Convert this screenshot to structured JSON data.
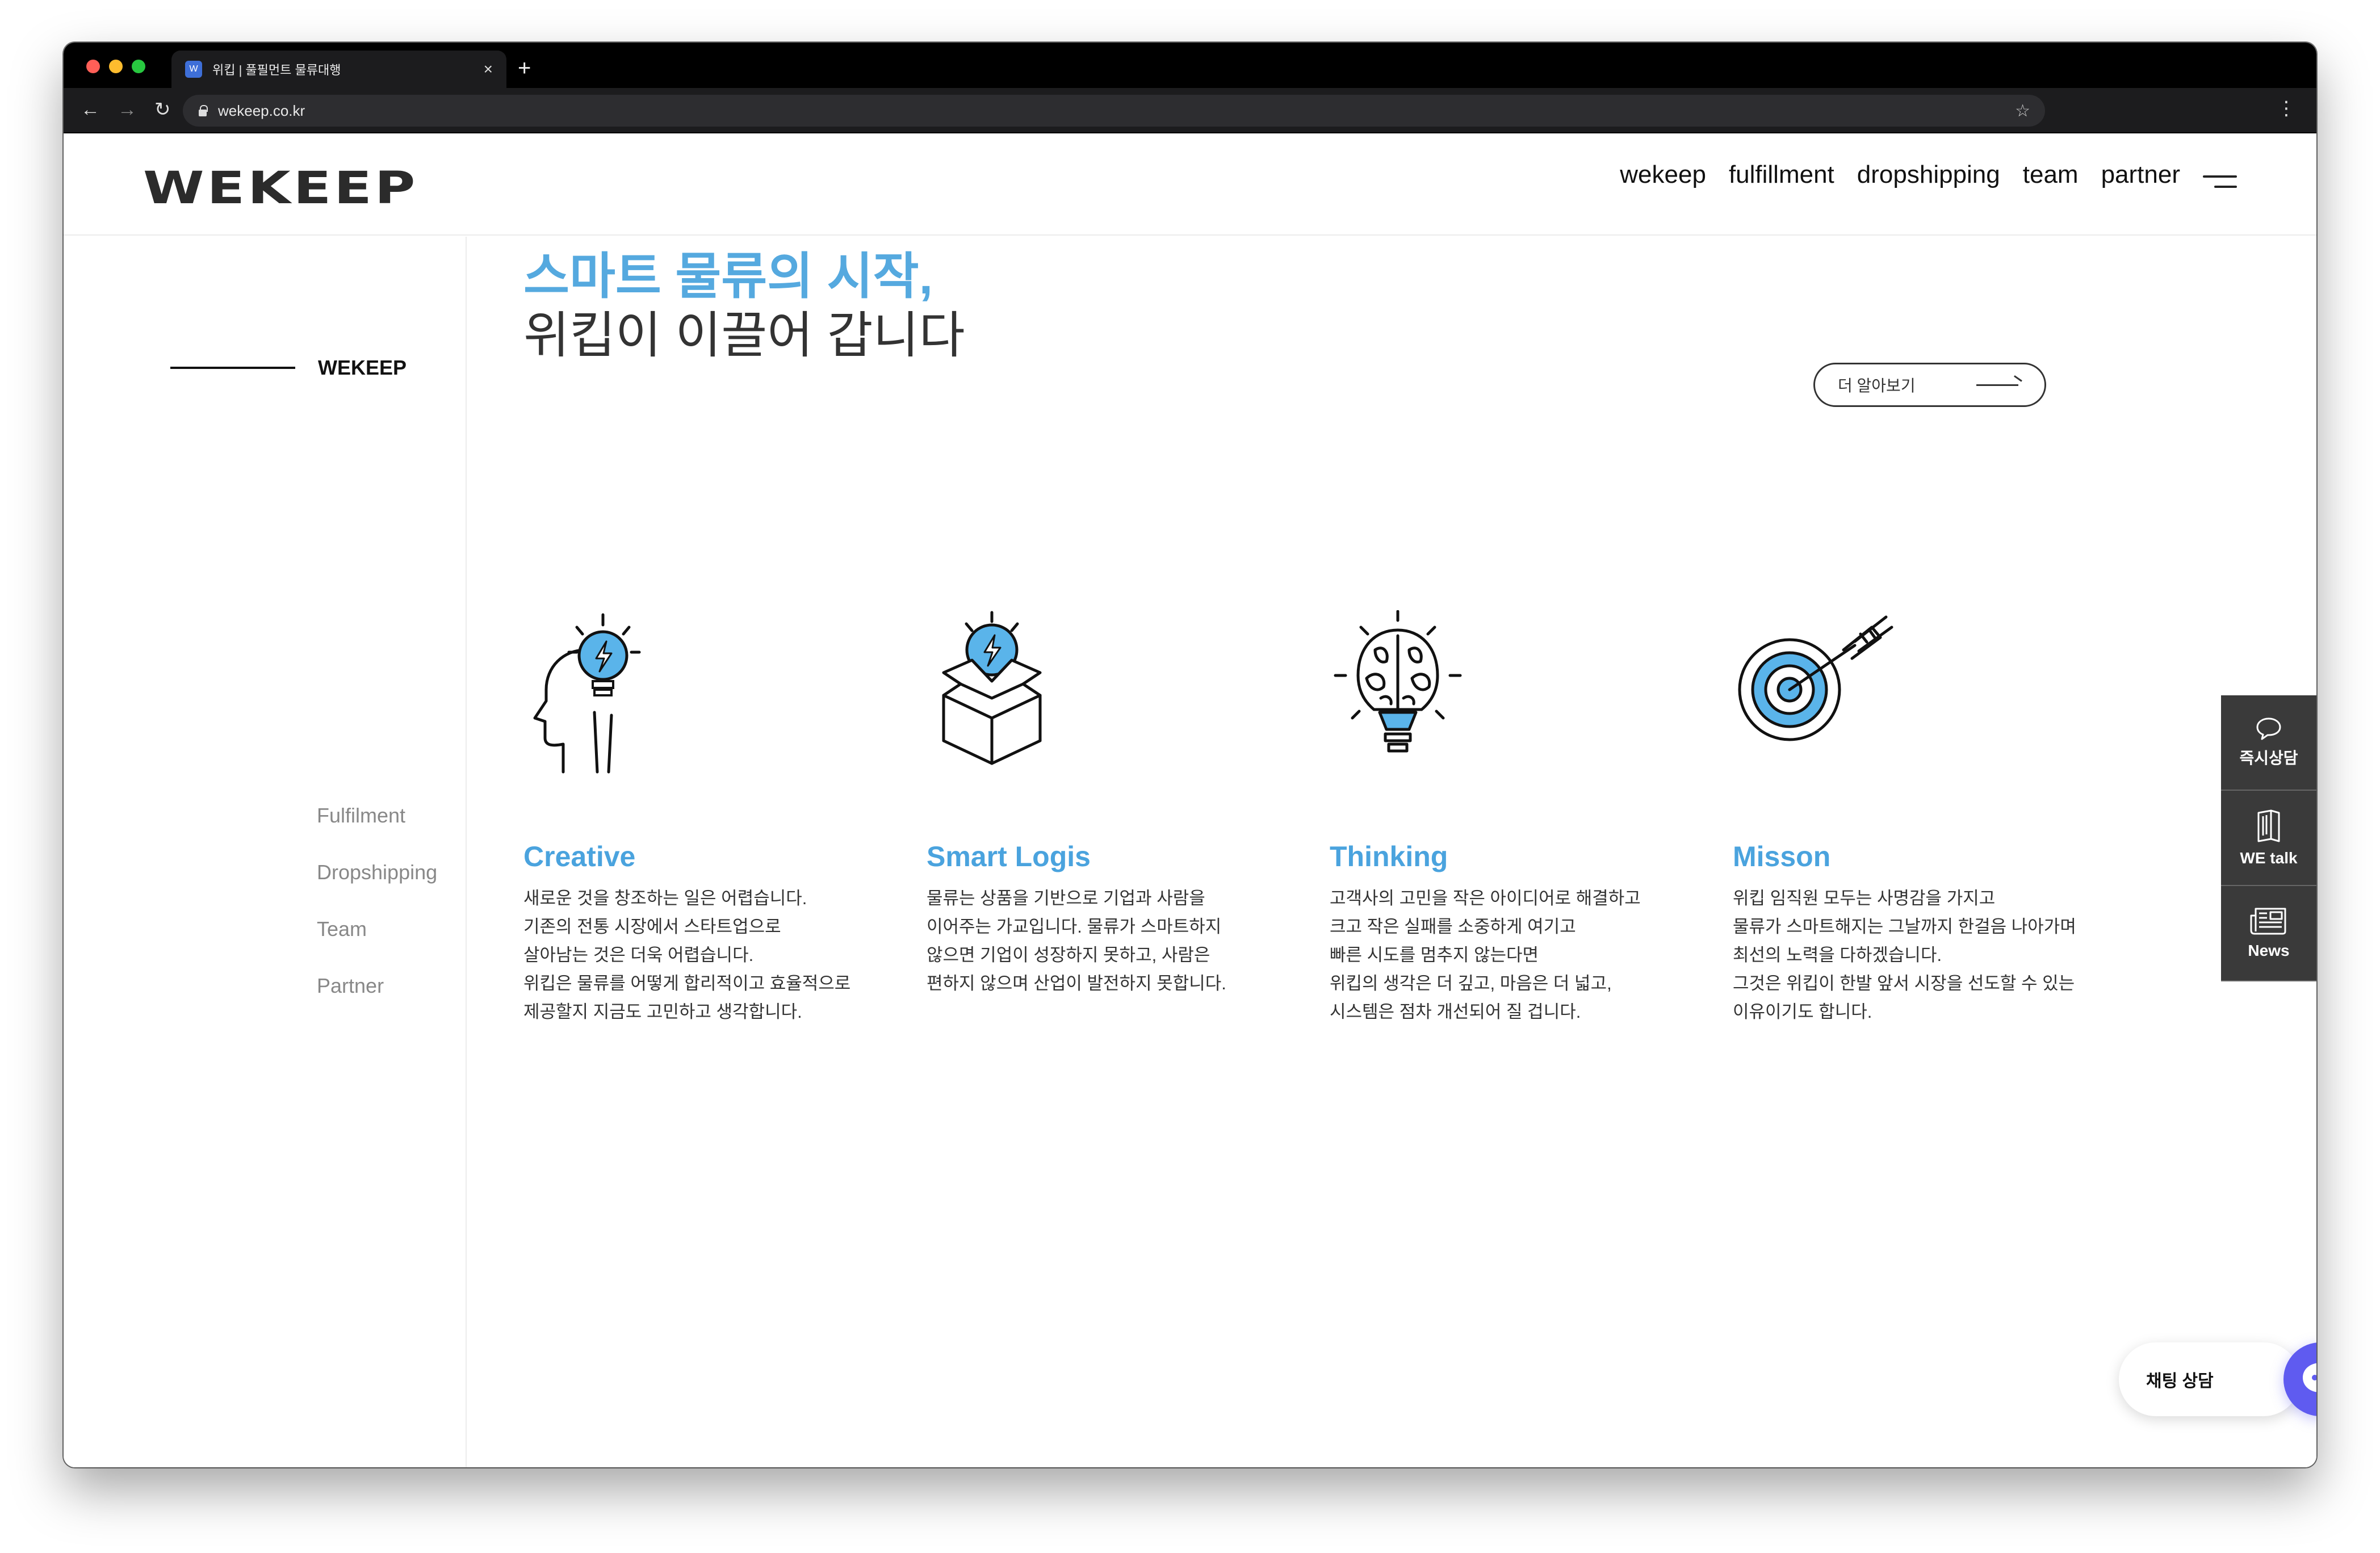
{
  "browser": {
    "tab_title": "위킵 | 풀필먼트 물류대행",
    "tab_close": "×",
    "new_tab": "+",
    "url": "wekeep.co.kr",
    "back": "←",
    "forward": "→",
    "reload": "↻",
    "star": "☆",
    "menu": "⋮"
  },
  "header": {
    "logo": "WEKEEP",
    "nav": [
      "wekeep",
      "fulfillment",
      "dropshipping",
      "team",
      "partner"
    ]
  },
  "sidebar": {
    "current": "WEKEEP",
    "items": [
      "Fulfilment",
      "Dropshipping",
      "Team",
      "Partner"
    ]
  },
  "hero": {
    "title_accent": "스마트 물류의 시작,",
    "title_main": "위킵이 이끌어 갑니다",
    "more_button": "더 알아보기"
  },
  "features": [
    {
      "title": "Creative",
      "icon": "idea-head-icon",
      "text": "새로운 것을 창조하는 일은 어렵습니다.\n기존의 전통 시장에서 스타트업으로\n살아남는 것은 더욱 어렵습니다.\n위킵은 물류를 어떻게 합리적이고 효율적으로\n제공할지 지금도 고민하고 생각합니다."
    },
    {
      "title": "Smart Logis",
      "icon": "box-bulb-icon",
      "text": "물류는 상품을 기반으로 기업과 사람을\n이어주는 가교입니다. 물류가 스마트하지\n않으면 기업이 성장하지 못하고, 사람은\n편하지 않으며 산업이 발전하지 못합니다."
    },
    {
      "title": "Thinking",
      "icon": "brain-bulb-icon",
      "text": "고객사의 고민을 작은 아이디어로 해결하고\n크고 작은 실패를 소중하게 여기고\n빠른 시도를 멈추지 않는다면\n위킵의 생각은 더 깊고, 마음은 더 넓고,\n시스템은 점차 개선되어 질 겁니다."
    },
    {
      "title": "Misson",
      "icon": "target-arrow-icon",
      "text": "위킵 임직원 모두는 사명감을 가지고\n물류가 스마트해지는 그날까지 한걸음 나아가며\n최선의 노력을 다하겠습니다.\n그것은 위킵이 한발 앞서 시장을 선도할 수 있는\n이유이기도 합니다."
    }
  ],
  "quick_menu": [
    {
      "label": "즉시상담",
      "icon": "speech-bubble-icon"
    },
    {
      "label": "WE talk",
      "icon": "book-icon"
    },
    {
      "label": "News",
      "icon": "newspaper-icon"
    }
  ],
  "chat": {
    "label": "채팅 상담",
    "icon": "chat-bot-icon"
  },
  "colors": {
    "accent": "#55a9df",
    "quick_menu_bg": "#3a3a3a",
    "chat_button": "#5f5bf0"
  }
}
